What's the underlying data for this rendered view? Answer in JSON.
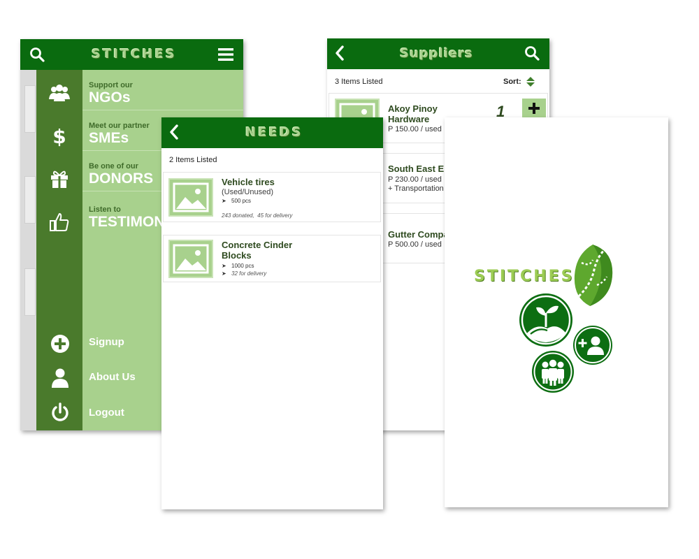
{
  "menu_screen": {
    "app_title": "STITCHES",
    "items": [
      {
        "small": "Support our",
        "big": "NGOs",
        "icon": "group-icon"
      },
      {
        "small": "Meet our partner",
        "big": "SMEs",
        "icon": "dollar-icon"
      },
      {
        "small": "Be one of our",
        "big": "DONORS",
        "icon": "gift-icon"
      },
      {
        "small": "Listen to",
        "big": "TESTIMONIES",
        "icon": "thumbs-up-icon"
      }
    ],
    "bottom_items": [
      {
        "label": "Signup",
        "icon": "plus-circle-icon"
      },
      {
        "label": "About Us",
        "icon": "user-icon"
      },
      {
        "label": "Logout",
        "icon": "power-icon"
      }
    ]
  },
  "needs_screen": {
    "title": "NEEDS",
    "count_label": "2 Items Listed",
    "items": [
      {
        "title": "Vehicle tires",
        "subtitle": "(Used/Unused)",
        "detail": "500 pcs",
        "status": "243 donated,  45 for delivery"
      },
      {
        "title": "Concrete Cinder Blocks",
        "detail": "1000 pcs",
        "status": "32 for delivery"
      }
    ]
  },
  "suppliers_screen": {
    "title": "Suppliers",
    "count_label": "3 Items Listed",
    "sort_label": "Sort:",
    "quantity": "1",
    "items": [
      {
        "name": "Akoy Pinoy Hardware",
        "price": "P 150.00 / used"
      },
      {
        "name": "South East Enterprises",
        "price": "P 230.00 / used",
        "extra": "+ Transportation"
      },
      {
        "name": "Gutter Company",
        "price": "P 500.00 / used"
      }
    ]
  },
  "splash_screen": {
    "brand": "STITCHES"
  },
  "colors": {
    "primary_dark": "#0a6b0f",
    "menu_rail": "#4a7a2c",
    "light_green": "#a8d18d",
    "text_dark_green": "#2e4a1f"
  }
}
